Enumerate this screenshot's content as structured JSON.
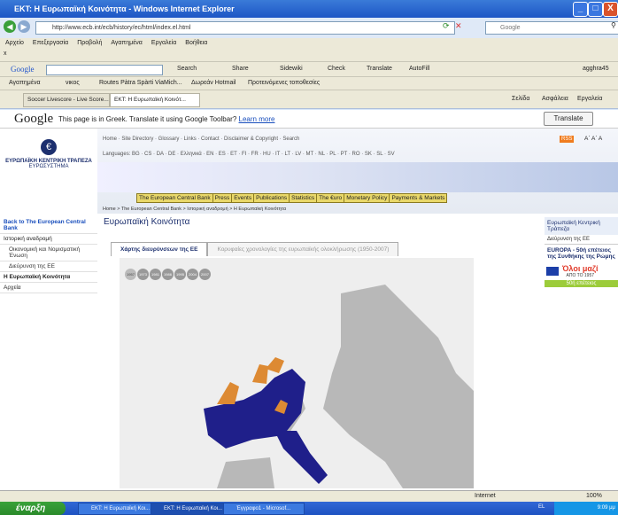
{
  "window": {
    "title": "EKT: Η Ευρωπαϊκή Κοινότητα - Windows Internet Explorer",
    "min": "_",
    "max": "□",
    "close": "X"
  },
  "address": {
    "url": "http://www.ecb.int/ecb/history/ec/html/index.el.html",
    "search_placeholder": "Google"
  },
  "menu": [
    "Αρχείο",
    "Επεξεργασία",
    "Προβολή",
    "Αγαπημένα",
    "Εργαλεία",
    "Βοήθεια"
  ],
  "toolbar1": {
    "close": "x"
  },
  "google_toolbar": {
    "logo": "Google",
    "items": [
      "Search",
      "Share",
      "Sidewiki",
      "Check",
      "Translate",
      "AutoFill"
    ],
    "user": "agghra45"
  },
  "favorites_bar": {
    "favorites": "Αγαπημένα",
    "items": [
      "νικος",
      "Routes Pàtra Spàrti ViaMich...",
      "Δωρεάν Hotmail",
      "Προτεινόμενες τοποθεσίες"
    ]
  },
  "tabs_bar": {
    "tabs": [
      "Soccer Livescore - Live Score...",
      "EKT: Η Ευρωπαϊκή Κοινότ..."
    ],
    "tools": [
      "Σελίδα",
      "Ασφάλεια",
      "Εργαλεία"
    ]
  },
  "translate_bar": {
    "logo": "Google",
    "message": "This page is in Greek. Translate it using Google Toolbar?",
    "learn_more": "Learn more",
    "button": "Translate"
  },
  "ecb": {
    "logo_text1": "ΕΥΡΩΠΑΪΚΗ ΚΕΝΤΡΙΚΗ ΤΡΑΠΕΖΑ",
    "logo_text2": "ΕΥΡΩΣΥΣΤΗΜΑ",
    "header_links": "Home · Site Directory · Glossary · Links · Contact · Disclaimer & Copyright · Search",
    "languages": "Languages: BG · CS · DA · DE · Ελληνικά · EN · ES · ET · FI · FR · HU · IT · LT · LV · MT · NL · PL · PT · RO · SK · SL · SV",
    "rss": "RSS",
    "font_size": "Α΄ Α΄ Α",
    "nav": [
      "The European Central Bank",
      "Press",
      "Events",
      "Publications",
      "Statistics",
      "The €uro",
      "Monetary Policy",
      "Payments & Markets"
    ],
    "breadcrumb": "Home > The European Central Bank > Ιστορική αναδρομή > Η Ευρωπαϊκή Κοινότητα",
    "left_nav": [
      "Back to The European Central Bank",
      "Ιστορική αναδρομή",
      "Οικονομική και Νομισματική Ένωση",
      "Διεύρυνση της ΕΕ",
      "Η Ευρωπαϊκή Κοινότητα",
      "Αρχεία"
    ],
    "page_title": "Ευρωπαϊκή Κοινότητα",
    "content_tabs": [
      "Χάρτης διευρύνσεων της ΕΕ",
      "Κορυφαίες χρονολογίες της ευρωπαϊκής ολοκλήρωσης (1950-2007)"
    ],
    "years": [
      "1957",
      "1973",
      "1981",
      "1986",
      "1995",
      "2004",
      "2007"
    ],
    "right_col": {
      "box1": "Ευρωπαϊκή Κεντρική Τράπεζα",
      "link1": "Διεύρυνση της ΕΕ",
      "box2": "EUROPA - 50ή επέτειος της Συνθήκης της Ρώμης",
      "logo_word": "Όλοι μαζί",
      "logo_sub": "ΑΠΟ ΤΟ 1957",
      "banner": "50ή επέτειος"
    }
  },
  "status": {
    "zone": "Internet",
    "zoom": "100%"
  },
  "taskbar": {
    "start": "έναρξη",
    "tasks": [
      "EKT: Η Ευρωπαϊκή Κοι...",
      "EKT: Η Ευρωπαϊκή Κοι...",
      "Έγγραφο1 - Microsof..."
    ],
    "lang": "EL",
    "clock": "9:09 μμ"
  }
}
